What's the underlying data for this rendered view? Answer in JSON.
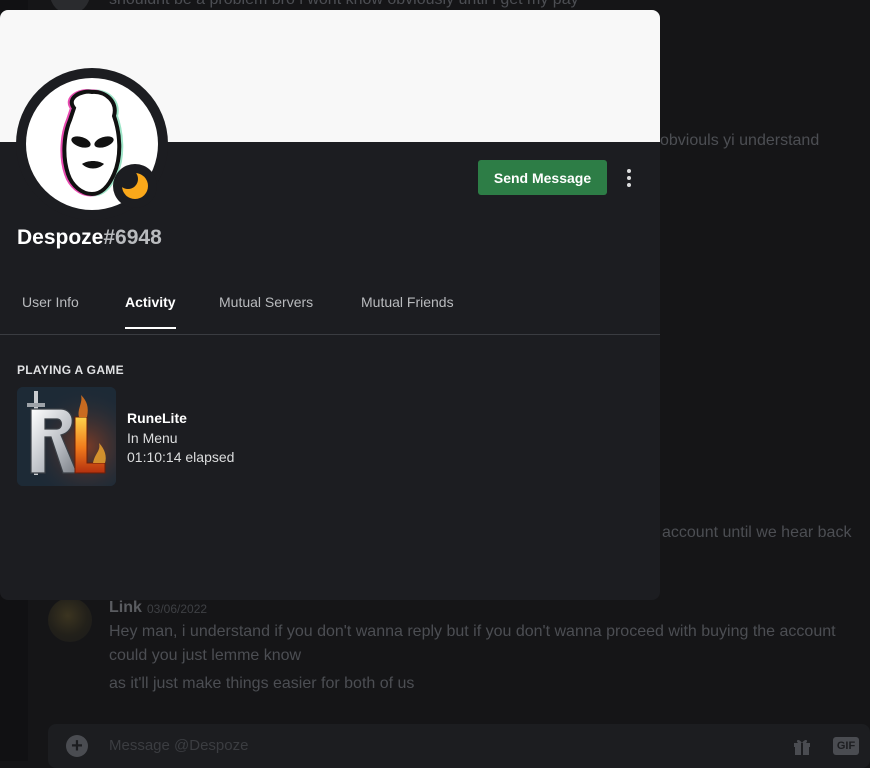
{
  "background_chat": {
    "lines": [
      {
        "text": "shouldnt be a problem bro i wont know obviously until i get my pay"
      },
      {
        "text": "obviouls yi understand"
      },
      {
        "text": "account until we hear back"
      }
    ],
    "message": {
      "author": "Link",
      "date": "03/06/2022",
      "lines": [
        "Hey man, i understand if you don't wanna reply but if you don't wanna proceed with buying the account",
        "could you just lemme know",
        "as it'll just make things easier for both of us"
      ]
    },
    "composer": {
      "placeholder": "Message @Despoze",
      "add_icon": "plus-circle-icon",
      "gift_icon": "gift-icon",
      "gif_label": "GIF"
    }
  },
  "profile": {
    "username": "Despoze",
    "discriminator": "#6948",
    "status": "idle",
    "status_icon": "moon-icon",
    "status_color": "#faa81a",
    "banner_color": "#f8f8f8",
    "send_message_label": "Send Message",
    "send_message_color": "#2d7d46",
    "more_icon": "more-vertical-icon",
    "tabs": [
      {
        "label": "User Info",
        "active": false
      },
      {
        "label": "Activity",
        "active": true
      },
      {
        "label": "Mutual Servers",
        "active": false
      },
      {
        "label": "Mutual Friends",
        "active": false
      }
    ],
    "activity": {
      "section_title": "PLAYING A GAME",
      "game_name": "RuneLite",
      "state": "In Menu",
      "elapsed": "01:10:14 elapsed",
      "icon": "runelite-icon"
    }
  }
}
